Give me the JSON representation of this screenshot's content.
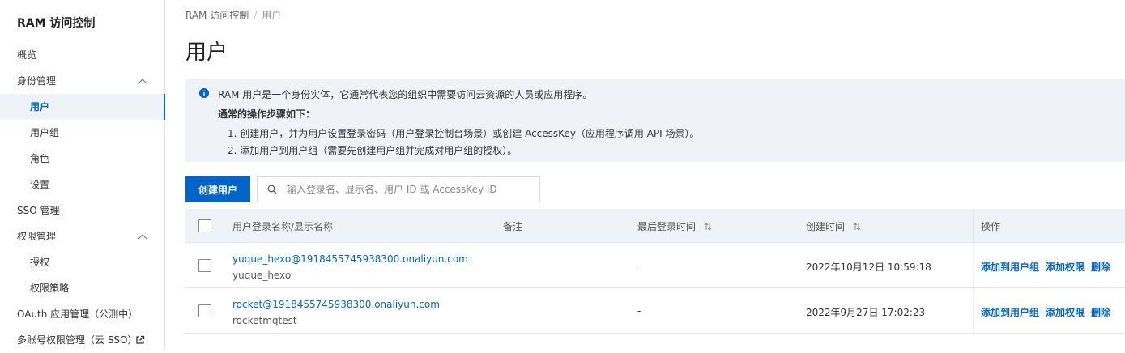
{
  "sidebar": {
    "title": "RAM 访问控制",
    "items": [
      {
        "label": "概览"
      },
      {
        "label": "身份管理"
      },
      {
        "label": "用户"
      },
      {
        "label": "用户组"
      },
      {
        "label": "角色"
      },
      {
        "label": "设置"
      },
      {
        "label": "SSO 管理"
      },
      {
        "label": "权限管理"
      },
      {
        "label": "授权"
      },
      {
        "label": "权限策略"
      },
      {
        "label": "OAuth 应用管理（公测中）"
      },
      {
        "label": "多账号权限管理（云 SSO）"
      }
    ]
  },
  "breadcrumb": {
    "root": "RAM 访问控制",
    "sep": "/",
    "current": "用户"
  },
  "page_title": "用户",
  "notice": {
    "intro": "RAM 用户是一个身份实体，它通常代表您的组织中需要访问云资源的人员或应用程序。",
    "steps_title": "通常的操作步骤如下：",
    "step1": "1. 创建用户，并为用户设置登录密码（用户登录控制台场景）或创建 AccessKey（应用程序调用 API 场景）。",
    "step2": "2. 添加用户到用户组（需要先创建用户组并完成对用户组的授权）。"
  },
  "toolbar": {
    "create_label": "创建用户",
    "search_placeholder": "输入登录名、显示名、用户 ID 或 AccessKey ID",
    "search_value": ""
  },
  "table": {
    "columns": [
      "用户登录名称/显示名称",
      "备注",
      "最后登录时间",
      "创建时间",
      "操作"
    ],
    "rows": [
      {
        "login": "yuque_hexo@1918455745938300.onaliyun.com",
        "display": "yuque_hexo",
        "remark": "",
        "last_login": "-",
        "created": "2022年10月12日 10:59:18",
        "actions": [
          "添加到用户组",
          "添加权限",
          "删除"
        ]
      },
      {
        "login": "rocket@1918455745938300.onaliyun.com",
        "display": "rocketmqtest",
        "remark": "",
        "last_login": "-",
        "created": "2022年9月27日 17:02:23",
        "actions": [
          "添加到用户组",
          "添加权限",
          "删除"
        ]
      }
    ]
  },
  "colors": {
    "primary": "#0064c8",
    "panel_bg": "#eff3f8",
    "border": "#e5e5e5"
  },
  "icons": [
    "info-icon",
    "search-icon",
    "chevron-up-icon",
    "external-link-icon",
    "sort-icon"
  ]
}
